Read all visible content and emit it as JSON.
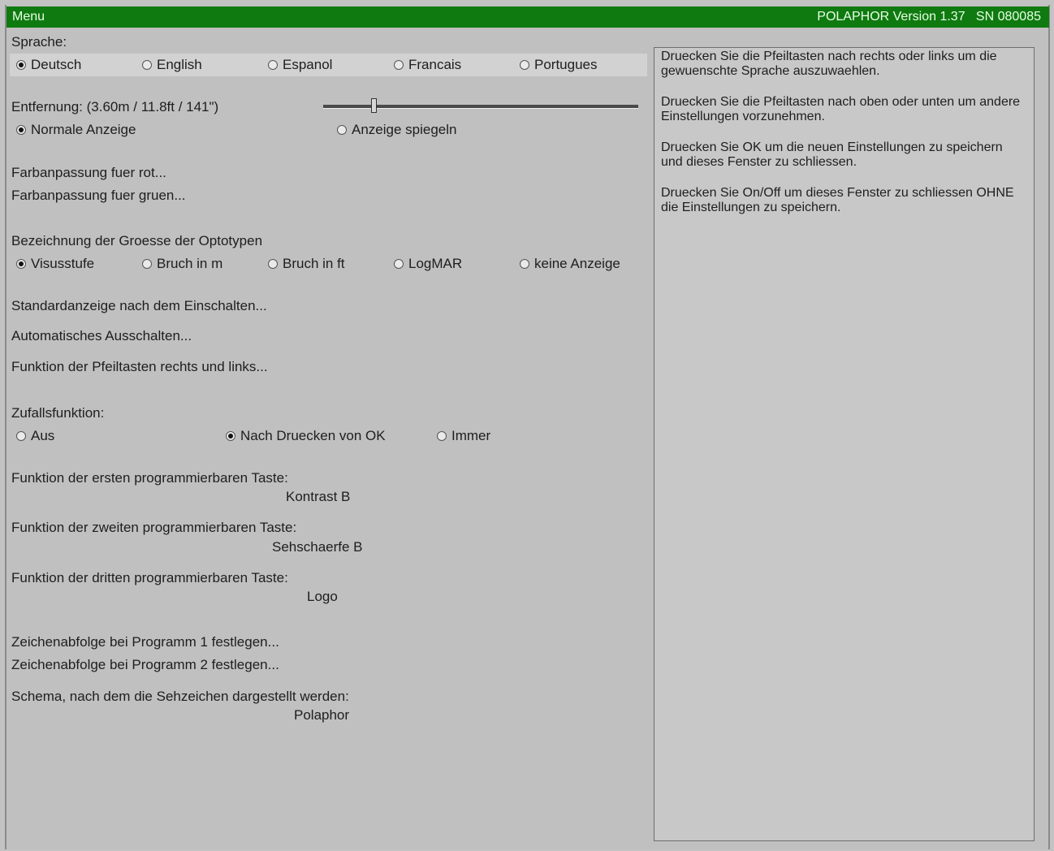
{
  "titlebar": {
    "menu_label": "Menu",
    "version_text": "POLAPHOR Version 1.37   SN 080085"
  },
  "language": {
    "label": "Sprache:",
    "options": [
      "Deutsch",
      "English",
      "Espanol",
      "Francais",
      "Portugues"
    ],
    "selected": "Deutsch"
  },
  "distance": {
    "label": "Entfernung: (3.60m / 11.8ft / 141\")",
    "slider_fraction": 0.16
  },
  "display": {
    "options": [
      "Normale Anzeige",
      "Anzeige spiegeln"
    ],
    "selected": "Normale Anzeige"
  },
  "color": {
    "red_label": "Farbanpassung fuer rot...",
    "green_label": "Farbanpassung fuer gruen..."
  },
  "optotype": {
    "label": "Bezeichnung der Groesse der Optotypen",
    "options": [
      "Visusstufe",
      "Bruch in m",
      "Bruch in ft",
      "LogMAR",
      "keine Anzeige"
    ],
    "selected": "Visusstufe"
  },
  "menu_links": {
    "standard": "Standardanzeige nach dem Einschalten...",
    "auto_off": "Automatisches Ausschalten...",
    "arrows": "Funktion der Pfeiltasten rechts und links..."
  },
  "random": {
    "label": "Zufallsfunktion:",
    "options": [
      "Aus",
      "Nach Druecken von OK",
      "Immer"
    ],
    "selected": "Nach Druecken von OK"
  },
  "prog_keys": [
    {
      "label": "Funktion der ersten programmierbaren Taste:",
      "value": "Kontrast B"
    },
    {
      "label": "Funktion der zweiten programmierbaren Taste:",
      "value": "Sehschaerfe B"
    },
    {
      "label": "Funktion der dritten programmierbaren Taste:",
      "value": "Logo"
    }
  ],
  "sequence": {
    "prog1": "Zeichenabfolge bei Programm 1 festlegen...",
    "prog2": "Zeichenabfolge bei Programm 2 festlegen..."
  },
  "scheme": {
    "label": "Schema, nach dem die Sehzeichen dargestellt werden:",
    "value": "Polaphor"
  },
  "help": {
    "paragraphs": [
      "Druecken Sie die Pfeiltasten nach rechts oder links um die gewuenschte Sprache auszuwaehlen.",
      "Druecken Sie die Pfeiltasten nach oben oder unten um andere Einstellungen vorzunehmen.",
      "Druecken Sie OK um die neuen Einstellungen zu speichern und dieses Fenster zu schliessen.",
      "Druecken Sie On/Off um dieses Fenster zu schliessen OHNE die Einstellungen zu speichern."
    ]
  }
}
